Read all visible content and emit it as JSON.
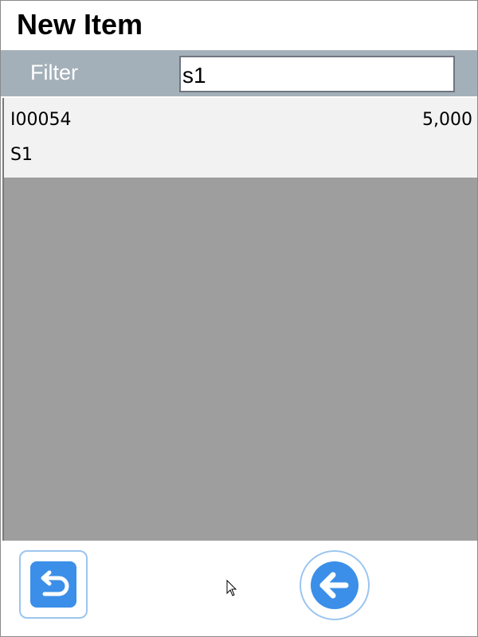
{
  "header": {
    "title": "New Item"
  },
  "filter": {
    "label": "Filter",
    "value": "s1"
  },
  "items": [
    {
      "code": "I00054",
      "quantity": "5,000",
      "name": "S1"
    }
  ],
  "footer": {
    "undo_icon": "undo-arrow-icon",
    "back_icon": "arrow-left-icon"
  },
  "colors": {
    "filter_bar": "#a4b0b9",
    "list_background": "#9e9e9e",
    "item_background": "#f2f2f2",
    "button_blue": "#3b8fe8",
    "button_border": "#9cc5f0"
  }
}
